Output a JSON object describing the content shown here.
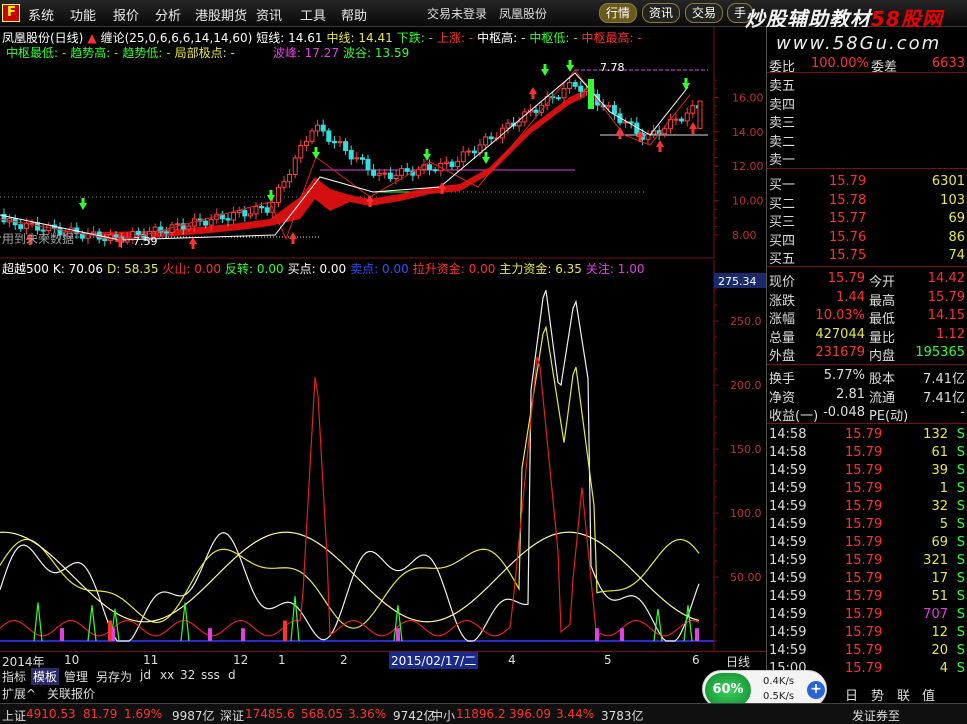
{
  "menu": {
    "items": [
      "系统",
      "功能",
      "报价",
      "分析",
      "港股期货",
      "资讯",
      "工具",
      "帮助"
    ],
    "center_links": [
      "交易未登录",
      "凤凰股份"
    ],
    "tabs": [
      "行情",
      "资讯",
      "交易",
      "手"
    ]
  },
  "watermark": {
    "prefix": "炒股辅助教材",
    "suffix": "58股网",
    "url": "www.58Gu.com"
  },
  "main_chart": {
    "line1": [
      "凤凰股份(日线)",
      "缠论(25,0,6,6,6,14,14,60)",
      "短线: 14.61",
      "中线: 14.41",
      "下跌: -",
      "上涨: -",
      "中枢高: -",
      "中枢低: -",
      "中枢最高: -"
    ],
    "line2": [
      "中枢最低: -",
      "趋势高: -",
      "趋势低: -",
      "局部极点: -",
      "波峰: 17.27",
      "波谷: 13.59"
    ],
    "price_labels": [
      "7.78",
      "7.59"
    ],
    "watermark_text": "用到未来数据",
    "y_ticks": [
      "16.00",
      "14.00",
      "12.00",
      "10.00",
      "8.00"
    ]
  },
  "indicator_chart": {
    "line": [
      "超越500",
      "K: 70.06",
      "D: 58.35",
      "火山: 0.00",
      "反转: 0.00",
      "买点: 0.00",
      "卖点: 0.00",
      "拉升资金: 0.00",
      "主力资金: 6.35",
      "关注: 1.00"
    ],
    "current_value": "275.34",
    "y_ticks": [
      "250.0",
      "200.0",
      "150.0",
      "100.0",
      "50.00"
    ]
  },
  "date_bar": {
    "labels": [
      "2014年",
      "10",
      "11",
      "12",
      "1",
      "2",
      "4",
      "5",
      "6"
    ],
    "cursor_date": "2015/02/17/二",
    "period": "日线"
  },
  "bottom_tabs": [
    "指标",
    "模板",
    "管理",
    "另存为",
    "jd",
    "xx",
    "32",
    "sss",
    "d"
  ],
  "ext_tabs": [
    "扩展^",
    "关联报价"
  ],
  "order_book": {
    "wei_bi": {
      "label": "委比",
      "value": "100.00%",
      "diff_label": "委差",
      "diff": "6633"
    },
    "sell": [
      {
        "label": "卖五",
        "price": "",
        "vol": ""
      },
      {
        "label": "卖四",
        "price": "",
        "vol": ""
      },
      {
        "label": "卖三",
        "price": "",
        "vol": ""
      },
      {
        "label": "卖二",
        "price": "",
        "vol": ""
      },
      {
        "label": "卖一",
        "price": "",
        "vol": ""
      }
    ],
    "buy": [
      {
        "label": "买一",
        "price": "15.79",
        "vol": "6301"
      },
      {
        "label": "买二",
        "price": "15.78",
        "vol": "103"
      },
      {
        "label": "买三",
        "price": "15.77",
        "vol": "69"
      },
      {
        "label": "买四",
        "price": "15.76",
        "vol": "86"
      },
      {
        "label": "买五",
        "price": "15.75",
        "vol": "74"
      }
    ]
  },
  "quote": [
    {
      "l1": "现价",
      "v1": "15.79",
      "c1": "#ff3030",
      "l2": "今开",
      "v2": "14.42",
      "c2": "#ff3030"
    },
    {
      "l1": "涨跌",
      "v1": "1.44",
      "c1": "#ff3030",
      "l2": "最高",
      "v2": "15.79",
      "c2": "#ff3030"
    },
    {
      "l1": "涨幅",
      "v1": "10.03%",
      "c1": "#ff3030",
      "l2": "最低",
      "v2": "14.15",
      "c2": "#ff3030"
    },
    {
      "l1": "总量",
      "v1": "427044",
      "c1": "#e8e840",
      "l2": "量比",
      "v2": "1.12",
      "c2": "#ff3030"
    },
    {
      "l1": "外盘",
      "v1": "231679",
      "c1": "#ff3030",
      "l2": "内盘",
      "v2": "195365",
      "c2": "#30ff30"
    }
  ],
  "stats": [
    {
      "l1": "换手",
      "v1": "5.77%",
      "l2": "股本",
      "v2": "7.41亿"
    },
    {
      "l1": "净资",
      "v1": "2.81",
      "l2": "流通",
      "v2": "7.41亿"
    },
    {
      "l1": "收益(一)",
      "v1": "-0.048",
      "l2": "PE(动)",
      "v2": "-"
    }
  ],
  "ticks": [
    {
      "time": "14:58",
      "price": "15.79",
      "vol": "132",
      "side": "S"
    },
    {
      "time": "14:58",
      "price": "15.79",
      "vol": "61",
      "side": "S"
    },
    {
      "time": "14:59",
      "price": "15.79",
      "vol": "39",
      "side": "S"
    },
    {
      "time": "14:59",
      "price": "15.79",
      "vol": "1",
      "side": "S"
    },
    {
      "time": "14:59",
      "price": "15.79",
      "vol": "32",
      "side": "S"
    },
    {
      "time": "14:59",
      "price": "15.79",
      "vol": "5",
      "side": "S"
    },
    {
      "time": "14:59",
      "price": "15.79",
      "vol": "69",
      "side": "S"
    },
    {
      "time": "14:59",
      "price": "15.79",
      "vol": "321",
      "side": "S"
    },
    {
      "time": "14:59",
      "price": "15.79",
      "vol": "17",
      "side": "S"
    },
    {
      "time": "14:59",
      "price": "15.79",
      "vol": "51",
      "side": "S"
    },
    {
      "time": "14:59",
      "price": "15.79",
      "vol": "707",
      "side": "S"
    },
    {
      "time": "14:59",
      "price": "15.79",
      "vol": "12",
      "side": "S"
    },
    {
      "time": "14:59",
      "price": "15.79",
      "vol": "20",
      "side": "S"
    },
    {
      "time": "15:00",
      "price": "15.79",
      "vol": "4",
      "side": "S"
    }
  ],
  "right_icons": [
    "日",
    "势",
    "联",
    "值",
    ""
  ],
  "speed": {
    "percent": "60%",
    "up": "0.4K/s",
    "down": "0.5K/s",
    "plus": "+"
  },
  "status": {
    "sh": {
      "name": "上证",
      "price": "4910.53",
      "chg": "81.79",
      "pct": "1.69%",
      "amt": "9987亿"
    },
    "sz": {
      "name": "深证",
      "price": "17485.6",
      "chg": "568.05",
      "pct": "3.36%",
      "amt": "9742亿"
    },
    "zx": {
      "name": "中小",
      "price": "11896.2",
      "chg": "396.09",
      "pct": "3.44%",
      "amt": "3783亿"
    },
    "note": "发证券至"
  },
  "colors": {
    "up": "#ff3030",
    "down": "#30ff30",
    "accent": "#e8e840"
  }
}
